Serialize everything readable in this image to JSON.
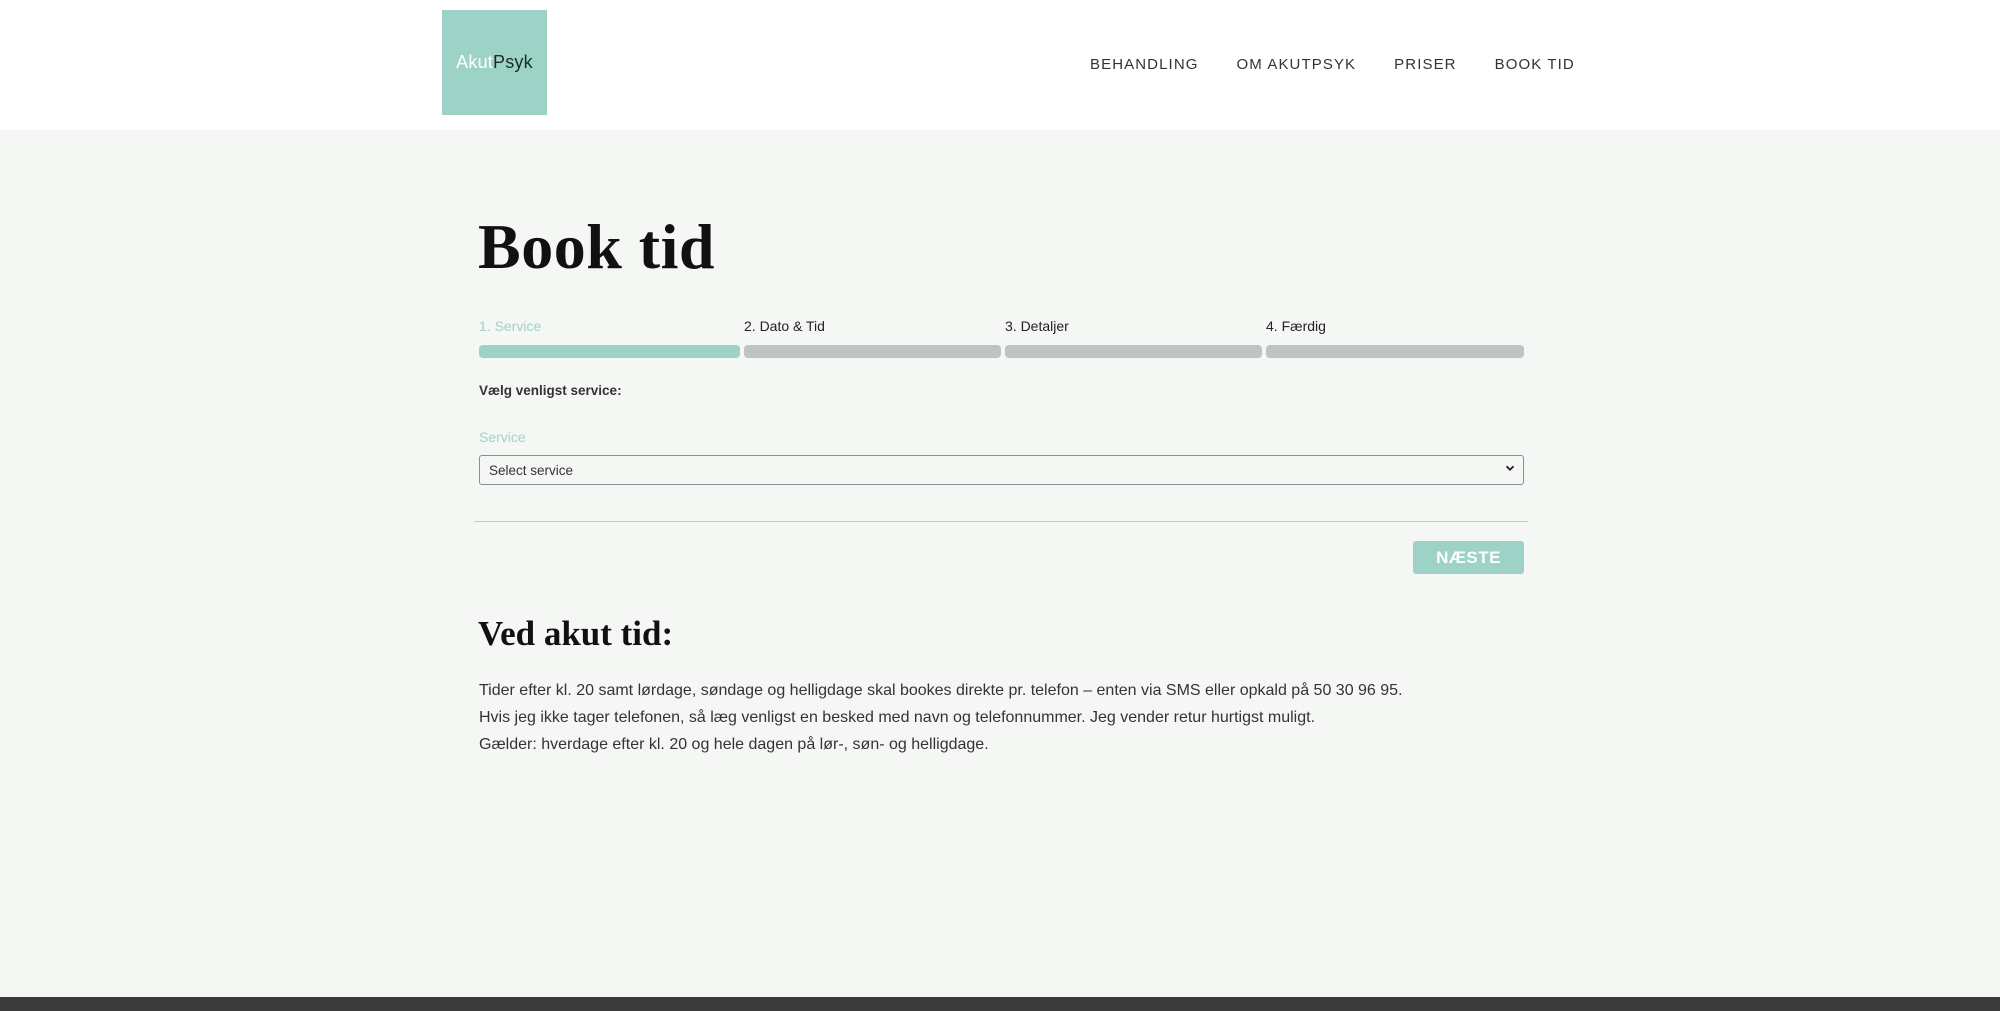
{
  "header": {
    "logo": {
      "part1": "Akut",
      "part2": "Psyk"
    },
    "nav": [
      "BEHANDLING",
      "OM AKUTPSYK",
      "PRISER",
      "BOOK TID"
    ]
  },
  "main": {
    "title": "Book tid",
    "steps": [
      {
        "label": "1. Service",
        "active": true
      },
      {
        "label": "2. Dato & Tid",
        "active": false
      },
      {
        "label": "3. Detaljer",
        "active": false
      },
      {
        "label": "4. Færdig",
        "active": false
      }
    ],
    "prompt": "Vælg venligst service:",
    "service_label": "Service",
    "service_select": {
      "selected": "Select service"
    },
    "next_button": "NÆSTE"
  },
  "urgent": {
    "title": "Ved akut tid:",
    "paragraphs": [
      "Tider efter kl. 20 samt lørdage, søndage og helligdage skal bookes direkte pr. telefon – enten via SMS eller opkald på 50 30 96 95.",
      "Hvis jeg ikke tager telefonen, så læg venligst en besked med navn og telefonnummer. Jeg vender retur hurtigst muligt.",
      "Gælder: hverdage efter kl. 20 og hele dagen på lør-, søn- og helligdage."
    ]
  },
  "colors": {
    "accent": "#9dd3c6",
    "inactive_bar": "#bec4c4",
    "background": "#f5f7f5",
    "footer": "#3a3a3a"
  }
}
